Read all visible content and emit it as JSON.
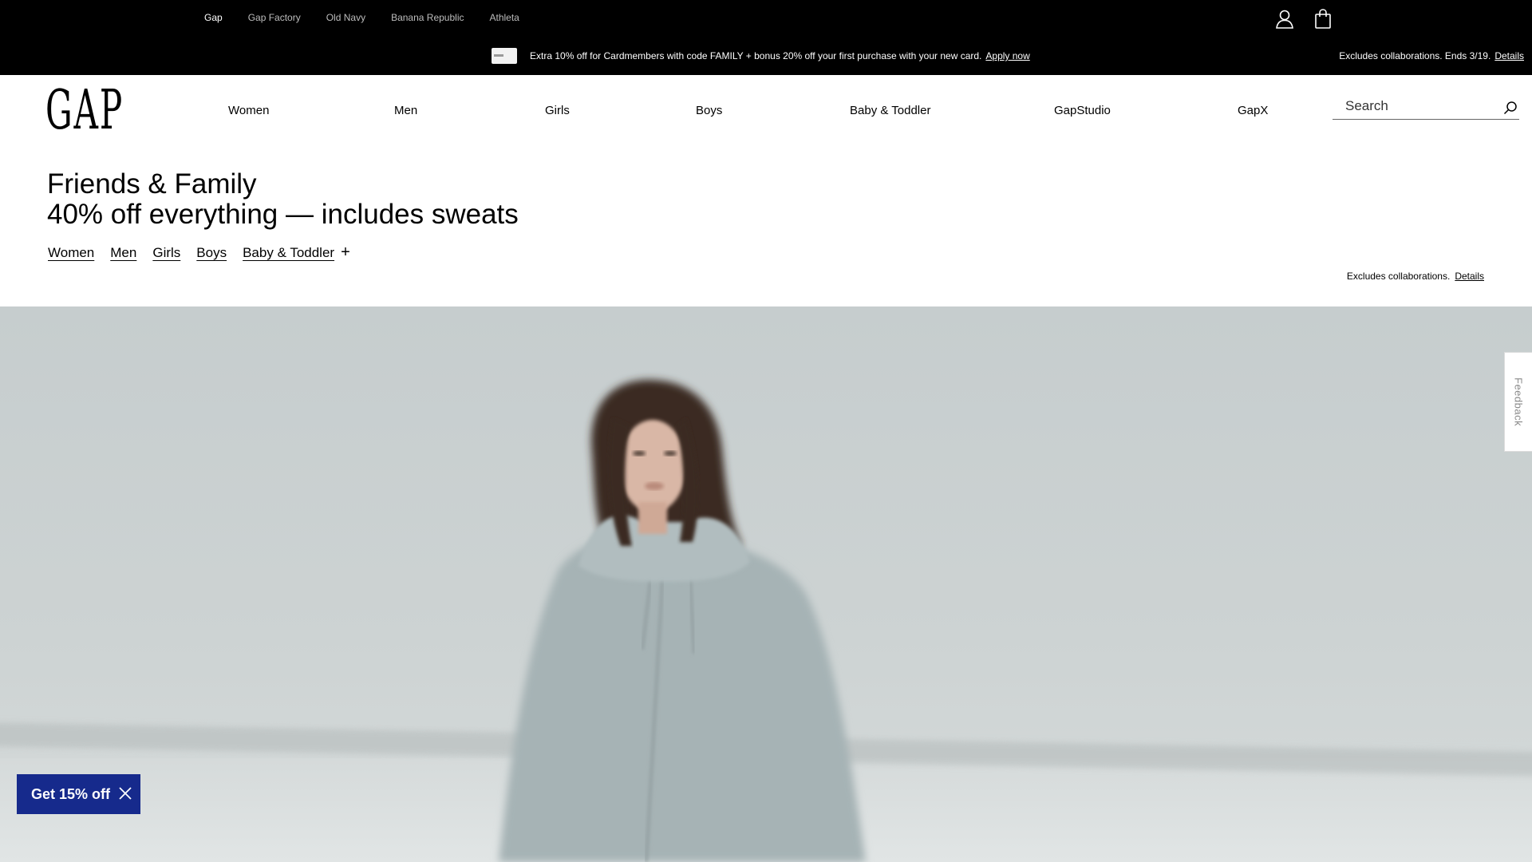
{
  "brand_bar": {
    "brands": [
      "Gap",
      "Gap Factory",
      "Old Navy",
      "Banana Republic",
      "Athleta"
    ],
    "active_brand": "Gap"
  },
  "promo_bar": {
    "text": "Extra 10% off for Cardmembers with code FAMILY + bonus 20% off your first purchase with your new card.",
    "apply_link": "Apply now",
    "right_text": "Excludes collaborations. Ends 3/19.",
    "details_link": "Details"
  },
  "header": {
    "logo": "GAP",
    "nav": [
      "Women",
      "Men",
      "Girls",
      "Boys",
      "Baby & Toddler",
      "GapStudio",
      "GapX"
    ],
    "search_placeholder": "Search"
  },
  "hero": {
    "headline_line1": "Friends & Family",
    "headline_line2": "40% off everything — includes sweats",
    "category_links": [
      "Women",
      "Men",
      "Girls",
      "Boys",
      "Baby & Toddler"
    ],
    "more_symbol": "+",
    "exclusion_text": "Excludes collaborations.",
    "exclusion_details": "Details"
  },
  "feedback_tab": "Feedback",
  "offer_badge": {
    "label": "Get 15% off"
  },
  "colors": {
    "top_bar": "#000000",
    "offer_badge": "#162a8c",
    "hero_background": "#c6cdce"
  }
}
